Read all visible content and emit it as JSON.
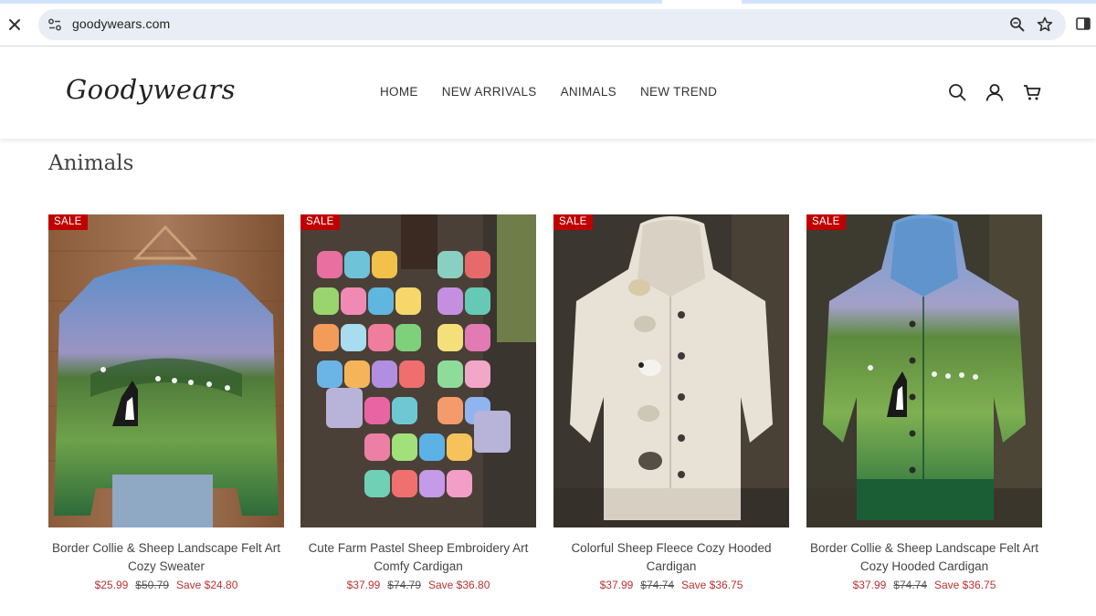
{
  "browser": {
    "url": "goodywears.com"
  },
  "site": {
    "logo": "Goodywears",
    "nav": [
      "HOME",
      "NEW ARRIVALS",
      "ANIMALS",
      "NEW TREND"
    ]
  },
  "page": {
    "title": "Animals"
  },
  "colors": {
    "sale_badge": "#c00000",
    "price": "#b83232"
  },
  "products": [
    {
      "badge": "SALE",
      "name": "Border Collie & Sheep Landscape Felt Art Cozy Sweater",
      "price": "$25.99",
      "compare_price": "$50.79",
      "save": "Save $24.80"
    },
    {
      "badge": "SALE",
      "name": "Cute Farm Pastel Sheep Embroidery Art Comfy Cardigan",
      "price": "$37.99",
      "compare_price": "$74.79",
      "save": "Save $36.80"
    },
    {
      "badge": "SALE",
      "name": "Colorful Sheep Fleece Cozy Hooded Cardigan",
      "price": "$37.99",
      "compare_price": "$74.74",
      "save": "Save $36.75"
    },
    {
      "badge": "SALE",
      "name": "Border Collie & Sheep Landscape Felt Art Cozy Hooded Cardigan",
      "price": "$37.99",
      "compare_price": "$74.74",
      "save": "Save $36.75"
    }
  ]
}
